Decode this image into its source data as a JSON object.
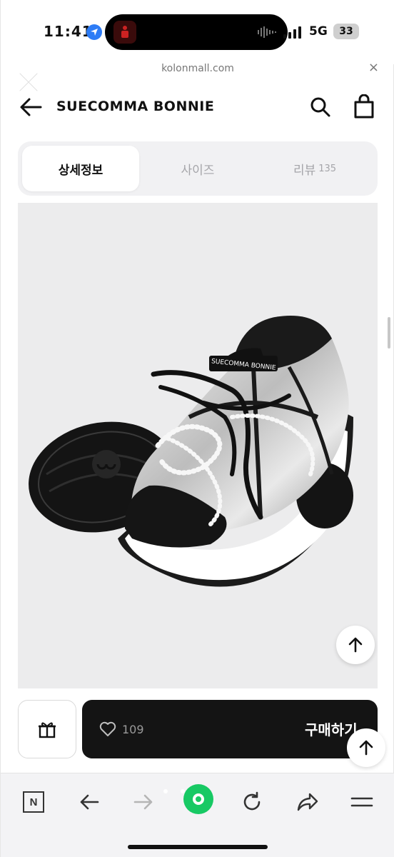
{
  "status_bar": {
    "time": "11:41",
    "network": "5G",
    "battery": "33"
  },
  "browser": {
    "url": "kolonmall.com",
    "close_symbol": "×"
  },
  "header": {
    "brand": "SUECOMMA BONNIE"
  },
  "tabs": [
    {
      "label": "상세정보",
      "active": true
    },
    {
      "label": "사이즈"
    },
    {
      "label": "리뷰",
      "count": "135"
    }
  ],
  "product": {
    "shoe_brand_print": "SUECOMMA BONNIE"
  },
  "buy_bar": {
    "likes": "109",
    "buy_label": "구매하기"
  },
  "toolbar": {
    "n_label": "N"
  },
  "colors": {
    "accent_dark": "#141414",
    "naver_green": "#17c964",
    "location_blue": "#2d7cf6"
  },
  "icons": [
    "location-arrow-icon",
    "close-icon",
    "back-arrow-icon",
    "search-icon",
    "shopping-bag-icon",
    "arrow-up-icon",
    "gift-icon",
    "heart-icon",
    "forward-arrow-icon",
    "refresh-icon",
    "share-icon",
    "menu-icon"
  ]
}
